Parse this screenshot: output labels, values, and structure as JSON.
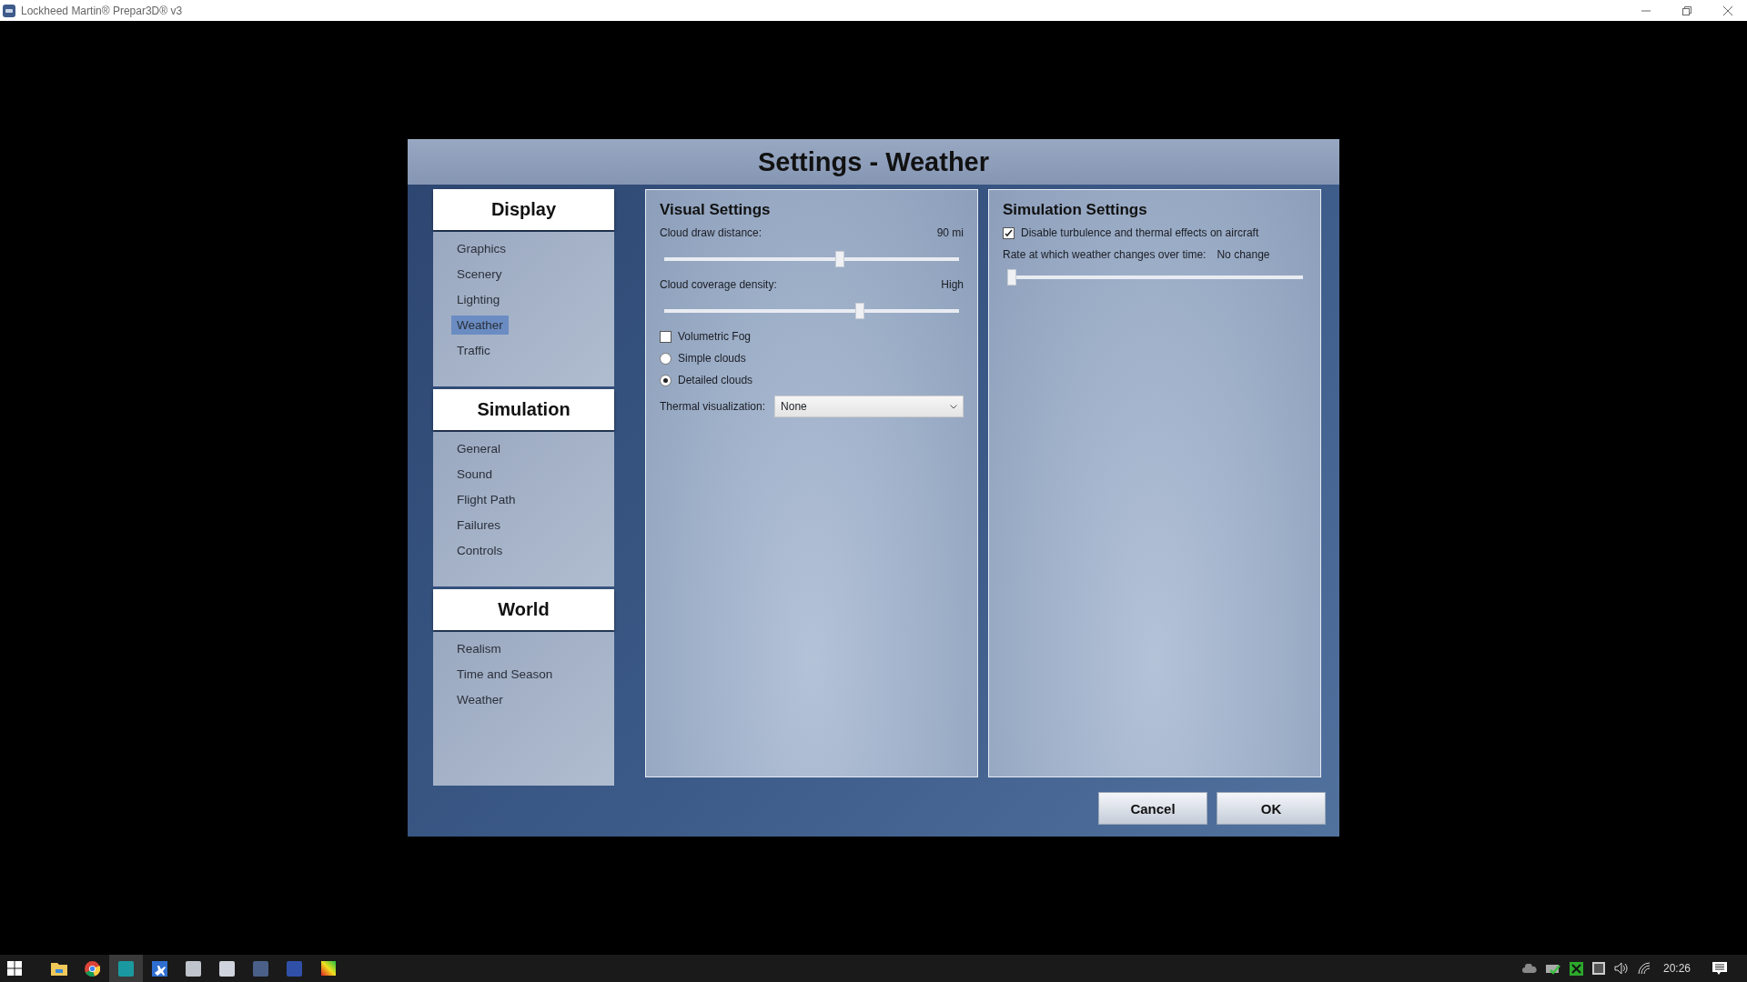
{
  "window": {
    "title": "Lockheed Martin® Prepar3D® v3"
  },
  "dialog": {
    "title": "Settings - Weather"
  },
  "sidebar": {
    "sections": [
      {
        "heading": "Display",
        "items": [
          {
            "label": "Graphics",
            "selected": false
          },
          {
            "label": "Scenery",
            "selected": false
          },
          {
            "label": "Lighting",
            "selected": false
          },
          {
            "label": "Weather",
            "selected": true
          },
          {
            "label": "Traffic",
            "selected": false
          }
        ]
      },
      {
        "heading": "Simulation",
        "items": [
          {
            "label": "General",
            "selected": false
          },
          {
            "label": "Sound",
            "selected": false
          },
          {
            "label": "Flight Path",
            "selected": false
          },
          {
            "label": "Failures",
            "selected": false
          },
          {
            "label": "Controls",
            "selected": false
          }
        ]
      },
      {
        "heading": "World",
        "items": [
          {
            "label": "Realism",
            "selected": false
          },
          {
            "label": "Time and Season",
            "selected": false
          },
          {
            "label": "Weather",
            "selected": false
          }
        ]
      }
    ]
  },
  "visual_settings": {
    "heading": "Visual Settings",
    "sliders": [
      {
        "label": "Cloud draw distance:",
        "reading": "90 mi",
        "level": 0.6
      },
      {
        "label": "Cloud coverage density:",
        "reading": "High",
        "level": 0.67
      }
    ],
    "options": [
      {
        "kind": "checkbox",
        "label": "Volumetric Fog",
        "checked": false
      },
      {
        "kind": "radio",
        "label": "Simple clouds",
        "selected": false
      },
      {
        "kind": "radio",
        "label": "Detailed clouds",
        "selected": true
      }
    ],
    "dropdown": {
      "label": "Thermal visualization:",
      "value": "None"
    }
  },
  "simulation_settings": {
    "heading": "Simulation Settings",
    "checkbox": {
      "label": "Disable turbulence and thermal effects on aircraft",
      "checked": true
    },
    "slider": {
      "label": "Rate at which weather changes over time:",
      "reading": "No change",
      "level": 0
    }
  },
  "buttons": [
    "Cancel",
    "OK"
  ],
  "taskbar": {
    "clock": "20:26"
  }
}
